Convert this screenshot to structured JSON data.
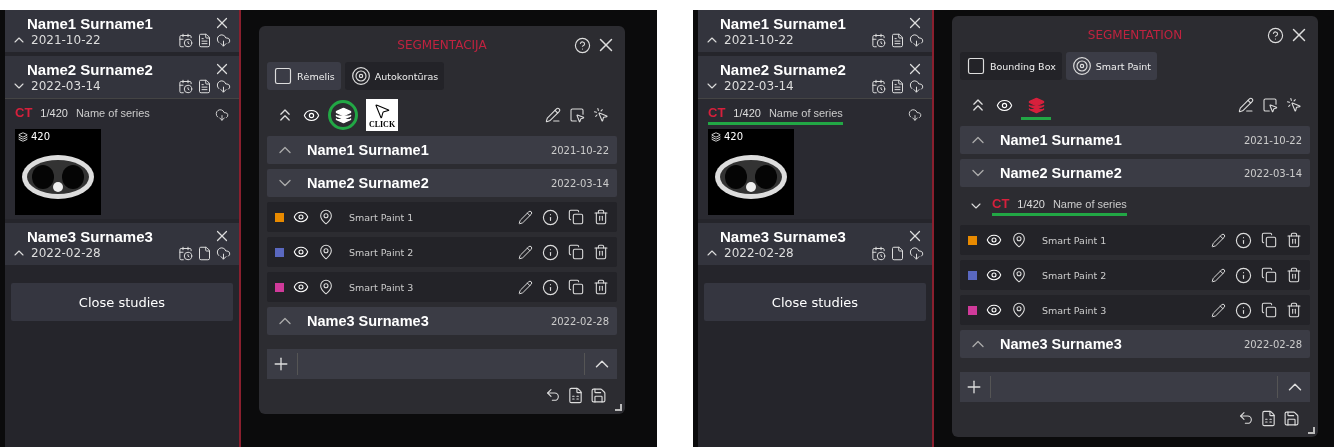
{
  "screens": [
    {
      "sidebar": {
        "studies": [
          {
            "name": "Name1 Surname1",
            "date": "2021-10-22",
            "expanded": false,
            "has_report": true
          },
          {
            "name": "Name2 Surname2",
            "date": "2022-03-14",
            "expanded": true,
            "has_report": true,
            "series": [
              {
                "modality": "CT",
                "count": "1/420",
                "name": "Name of series",
                "thumbnail_count": "420",
                "highlighted": false
              }
            ]
          },
          {
            "name": "Name3 Surname3",
            "date": "2022-02-28",
            "expanded": false,
            "has_report": false
          }
        ],
        "close_button": "Close studies"
      },
      "panel": {
        "title": "SEGMENTACIJA",
        "tabs": [
          {
            "label": "Rėmelis",
            "kind": "box",
            "selected": true
          },
          {
            "label": "Autokontūras",
            "kind": "paint",
            "selected": false
          }
        ],
        "layers": {
          "active": false,
          "circled": true,
          "underlined": false
        },
        "click_hint": {
          "label": "CLICK"
        },
        "studies": [
          {
            "name": "Name1 Surname1",
            "date": "2021-10-22",
            "expanded": false
          },
          {
            "name": "Name2 Surname2",
            "date": "2022-03-14",
            "expanded": true,
            "segments": [
              {
                "name": "Smart Paint 1",
                "color": "#e88a00"
              },
              {
                "name": "Smart Paint 2",
                "color": "#5a68c0"
              },
              {
                "name": "Smart Paint 3",
                "color": "#d03a9a"
              }
            ]
          },
          {
            "name": "Name3 Surname3",
            "date": "2022-02-28",
            "expanded": false
          }
        ]
      }
    },
    {
      "sidebar": {
        "studies": [
          {
            "name": "Name1 Surname1",
            "date": "2021-10-22",
            "expanded": false,
            "has_report": true
          },
          {
            "name": "Name2 Surname2",
            "date": "2022-03-14",
            "expanded": true,
            "has_report": true,
            "series": [
              {
                "modality": "CT",
                "count": "1/420",
                "name": "Name of series",
                "thumbnail_count": "420",
                "highlighted": true
              }
            ]
          },
          {
            "name": "Name3 Surname3",
            "date": "2022-02-28",
            "expanded": false,
            "has_report": false
          }
        ],
        "close_button": "Close studies"
      },
      "panel": {
        "title": "SEGMENTATION",
        "tabs": [
          {
            "label": "Bounding Box",
            "kind": "box",
            "selected": false
          },
          {
            "label": "Smart Paint",
            "kind": "paint",
            "selected": true
          }
        ],
        "layers": {
          "active": true,
          "circled": false,
          "underlined": true
        },
        "studies": [
          {
            "name": "Name1 Surname1",
            "date": "2021-10-22",
            "expanded": false
          },
          {
            "name": "Name2 Surname2",
            "date": "2022-03-14",
            "expanded": true,
            "series": [
              {
                "modality": "CT",
                "count": "1/420",
                "name": "Name of series",
                "expanded": true,
                "highlighted": true,
                "segments": [
                  {
                    "name": "Smart Paint 1",
                    "color": "#e88a00"
                  },
                  {
                    "name": "Smart Paint 2",
                    "color": "#5a68c0"
                  },
                  {
                    "name": "Smart Paint 3",
                    "color": "#d03a9a"
                  }
                ]
              }
            ]
          },
          {
            "name": "Name3 Surname3",
            "date": "2022-02-28",
            "expanded": false
          }
        ]
      }
    }
  ]
}
